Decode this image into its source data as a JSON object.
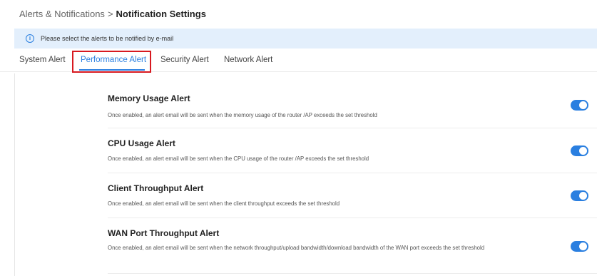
{
  "breadcrumb": {
    "parent": "Alerts & Notifications",
    "separator": ">",
    "current": "Notification Settings"
  },
  "info_bar": {
    "icon": "info-icon",
    "text": "Please select the alerts to be notified by e-mail"
  },
  "tabs": [
    {
      "label": "System Alert",
      "active": false
    },
    {
      "label": "Performance Alert",
      "active": true
    },
    {
      "label": "Security Alert",
      "active": false
    },
    {
      "label": "Network Alert",
      "active": false
    }
  ],
  "alerts": [
    {
      "title": "Memory Usage Alert",
      "description": "Once enabled, an alert email will be sent when the memory usage of the router /AP exceeds the set threshold",
      "enabled": true
    },
    {
      "title": "CPU Usage Alert",
      "description": "Once enabled, an alert email will be sent when the CPU usage of the router /AP exceeds the set threshold",
      "enabled": true
    },
    {
      "title": "Client Throughput Alert",
      "description": "Once enabled, an alert email will be sent when the client throughput exceeds the set threshold",
      "enabled": true
    },
    {
      "title": "WAN Port Throughput Alert",
      "description": "Once enabled, an alert email will be sent when the network throughput/upload bandwidth/download bandwidth of the WAN port exceeds the set threshold",
      "enabled": true
    }
  ],
  "colors": {
    "accent": "#2a7fe0",
    "highlight_box": "#d71920",
    "info_bar_bg": "#e3effc"
  }
}
